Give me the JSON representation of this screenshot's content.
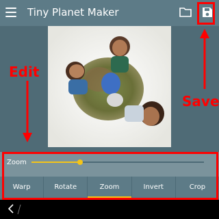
{
  "app": {
    "title": "Tiny Planet Maker"
  },
  "annotations": {
    "edit": "Edit",
    "save": "Save"
  },
  "toolbar": {
    "menu_icon": "hamburger-menu-icon",
    "open_icon": "folder-icon",
    "save_icon": "save-floppy-icon"
  },
  "zoom": {
    "label": "Zoom",
    "value_fraction": 0.28
  },
  "tabs": [
    {
      "label": "Warp",
      "active": false
    },
    {
      "label": "Rotate",
      "active": false
    },
    {
      "label": "Zoom",
      "active": true
    },
    {
      "label": "Invert",
      "active": false
    },
    {
      "label": "Crop",
      "active": false
    }
  ],
  "colors": {
    "accent": "#f5c518",
    "annotation": "#ff0000",
    "appbar": "#5d7b87",
    "panel": "#7b939c"
  }
}
